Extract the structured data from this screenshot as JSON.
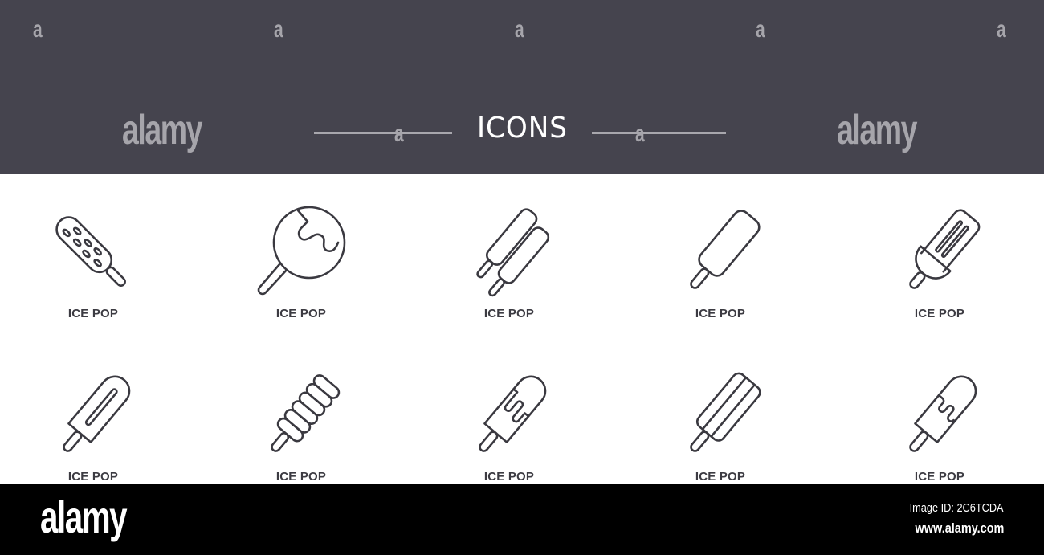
{
  "header": {
    "title": "ICONS",
    "watermark_letter": "a",
    "watermark_logo": "alamy",
    "background_color": "#45444e"
  },
  "icons": [
    {
      "name": "ice-pop-sprinkles",
      "label": "ICE POP"
    },
    {
      "name": "ice-pop-round-dipped",
      "label": "ICE POP"
    },
    {
      "name": "ice-pop-double",
      "label": "ICE POP"
    },
    {
      "name": "ice-pop-plain",
      "label": "ICE POP"
    },
    {
      "name": "ice-pop-half-dipped-grooves",
      "label": "ICE POP"
    },
    {
      "name": "ice-pop-single-groove",
      "label": "ICE POP"
    },
    {
      "name": "ice-pop-twisted",
      "label": "ICE POP"
    },
    {
      "name": "ice-pop-dripping",
      "label": "ICE POP"
    },
    {
      "name": "ice-pop-striped",
      "label": "ICE POP"
    },
    {
      "name": "ice-pop-chocolate-top",
      "label": "ICE POP"
    }
  ],
  "footer": {
    "logo": "alamy",
    "image_id": "Image ID: 2C6TCDA",
    "url": "www.alamy.com"
  }
}
